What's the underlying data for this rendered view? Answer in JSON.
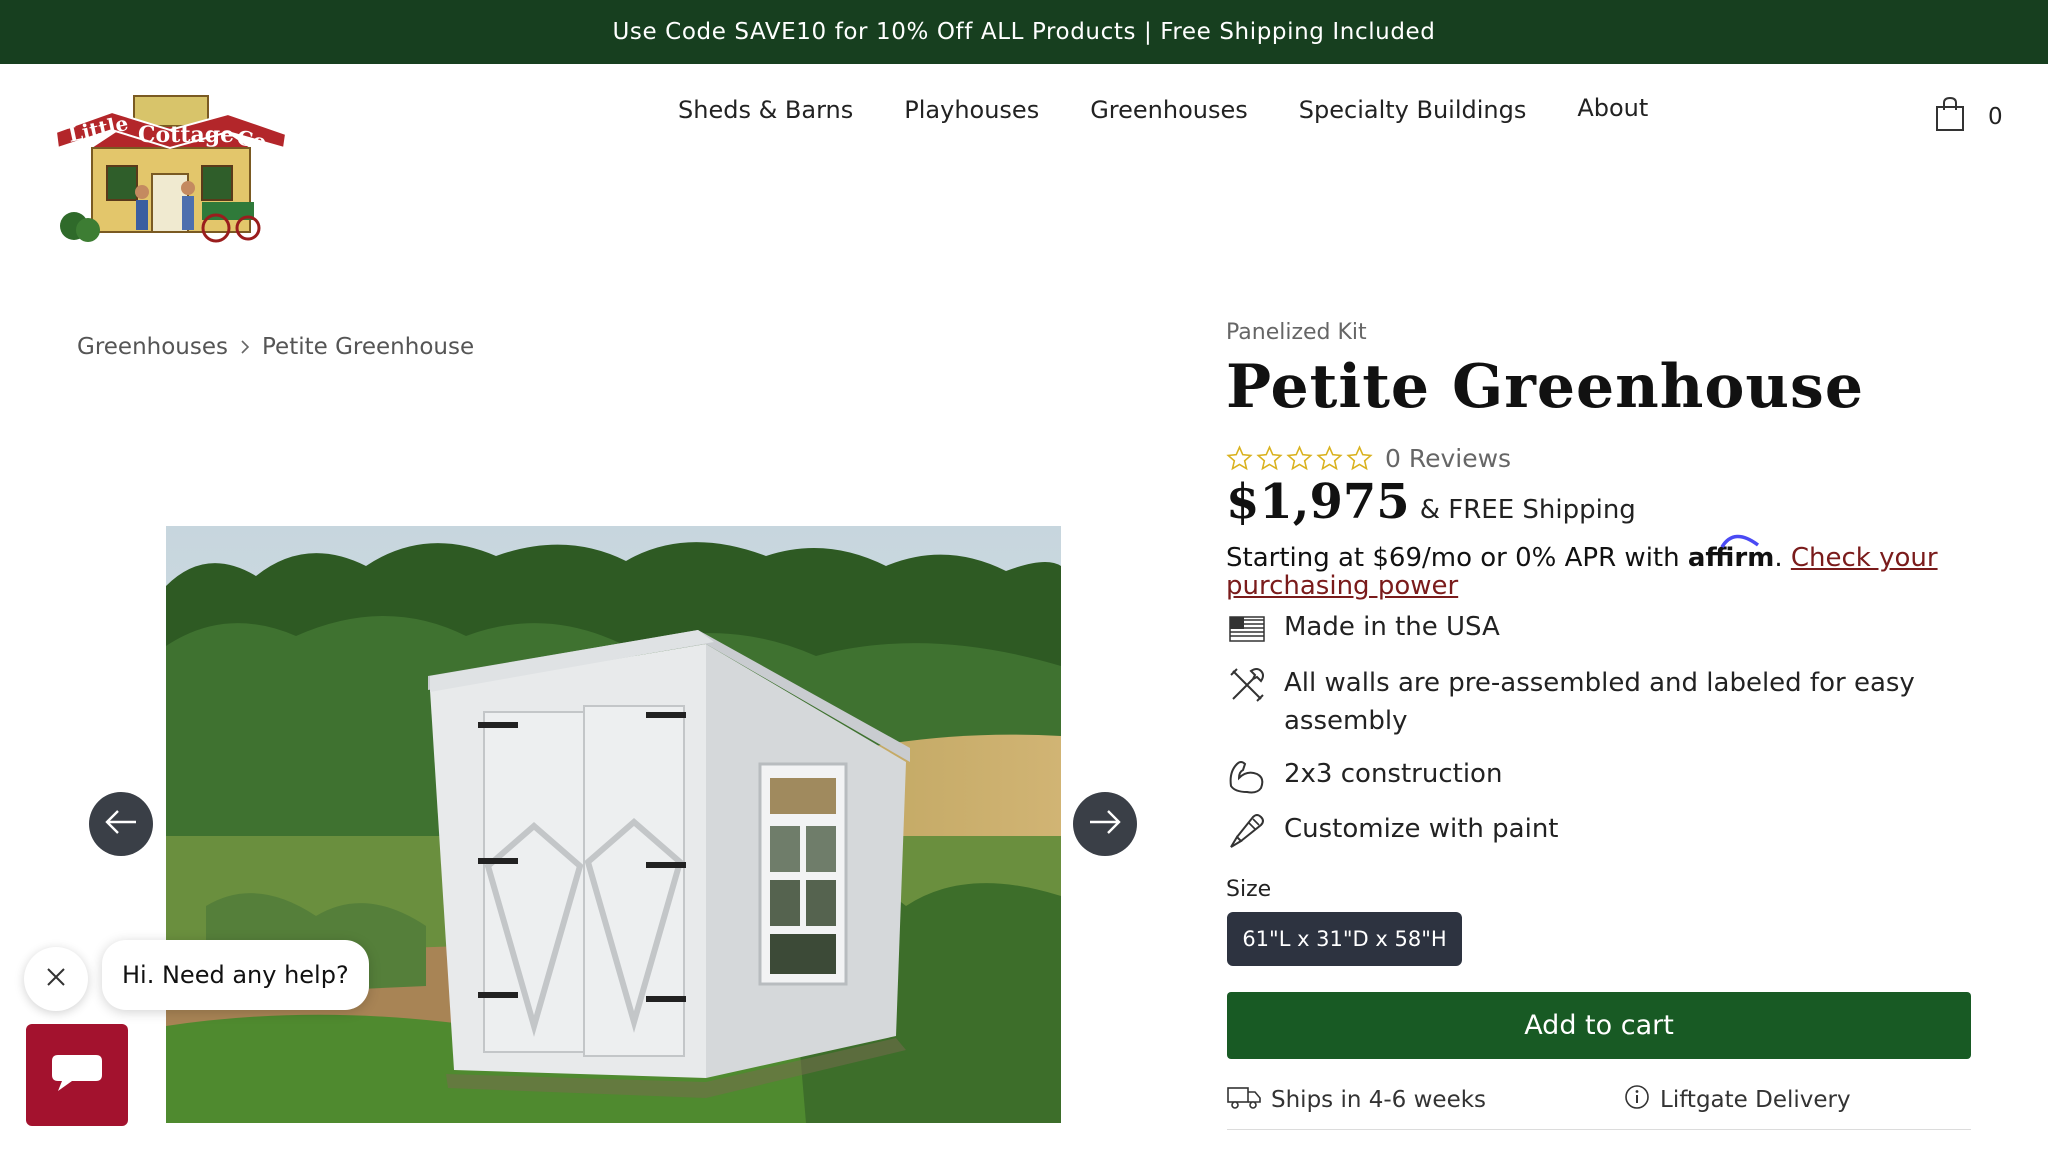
{
  "announcement": {
    "text": "Use Code SAVE10 for 10% Off ALL Products | Free Shipping Included"
  },
  "logo": {
    "alt": "Little Cottage Co."
  },
  "nav": {
    "items": [
      "Sheds & Barns",
      "Playhouses",
      "Greenhouses",
      "Specialty Buildings",
      "About"
    ]
  },
  "cart": {
    "count": "0",
    "icon": "shopping-bag-icon"
  },
  "breadcrumb": {
    "parent": "Greenhouses",
    "current": "Petite Greenhouse"
  },
  "product": {
    "kit_label": "Panelized Kit",
    "title": "Petite Greenhouse",
    "rating": 0,
    "rating_max": 5,
    "reviews": "0 Reviews",
    "price": "$1,975",
    "shipping": "& FREE Shipping",
    "financing_prefix": "Starting at $69/mo or 0% APR with",
    "affirm_brand": "affirm",
    "financing_link": "Check your purchasing power",
    "features": [
      {
        "icon": "us-flag-icon",
        "text": "Made in the USA"
      },
      {
        "icon": "tools-icon",
        "text": "All walls are pre-assembled and labeled for easy assembly"
      },
      {
        "icon": "flexed-arm-icon",
        "text": "2x3 construction"
      },
      {
        "icon": "paintbrush-icon",
        "text": "Customize with paint"
      }
    ],
    "size_label": "Size",
    "size_selected": "61\"L x 31\"D x 58\"H",
    "add_to_cart": "Add to cart",
    "ships": "Ships in 4-6 weeks",
    "delivery": "Liftgate Delivery"
  },
  "chat": {
    "greeting": "Hi. Need any help?"
  },
  "colors": {
    "announcement_bg": "#173f1f",
    "primary_green": "#185a24",
    "size_button_bg": "#2d3340",
    "chat_red": "#a3122e",
    "star_gold": "#d9b21f",
    "link_maroon": "#7a1b1b"
  }
}
